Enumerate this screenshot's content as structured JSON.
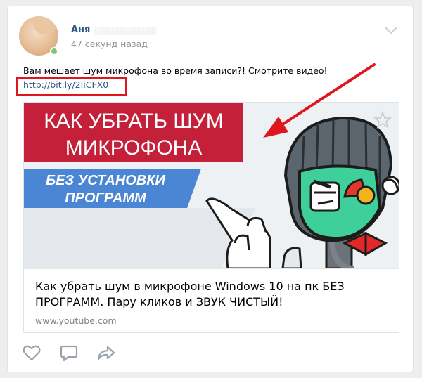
{
  "post": {
    "author": "Аня",
    "time": "47 секунд назад",
    "text": "Вам мешает шум микрофона во время записи?! Смотрите видео!",
    "link": "http://bit.ly/2IiCFX0"
  },
  "attachment": {
    "thumb_title_line1": "КАК УБРАТЬ ШУМ",
    "thumb_title_line2": "МИКРОФОНА",
    "thumb_banner_line1": "БЕЗ УСТАНОВКИ",
    "thumb_banner_line2": "ПРОГРАММ",
    "title": "Как убрать шум в микрофоне Windows 10 на пк БЕЗ ПРОГРАММ. Пару кликов и ЗВУК ЧИСТЫЙ!",
    "domain": "www.youtube.com"
  },
  "icons": {
    "like": "heart-icon",
    "comment": "comment-icon",
    "share": "share-arrow-icon",
    "favorite": "star-icon",
    "menu": "chevron-down-icon"
  },
  "colors": {
    "link": "#2a5885",
    "highlight": "#e0161f",
    "title_banner": "#c4203a",
    "sub_banner": "#4a86d4",
    "icon": "#99a2ad"
  }
}
